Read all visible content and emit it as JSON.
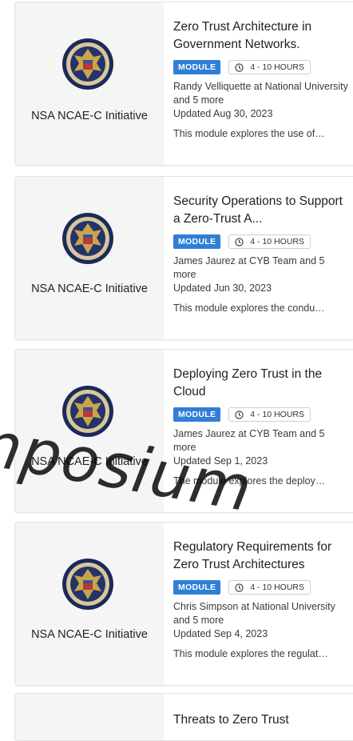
{
  "cards": [
    {
      "org": "NSA NCAE-C Initiative",
      "title": "Zero Trust Architecture in Government Networks.",
      "badge": "MODULE",
      "duration": "4 - 10 HOURS",
      "authors": "Randy Velliquette at National University and 5 more",
      "updated": "Updated Aug 30, 2023",
      "description": "This module explores the use of…"
    },
    {
      "org": "NSA NCAE-C Initiative",
      "title": "Security Operations to Support a Zero-Trust A...",
      "badge": "MODULE",
      "duration": "4 - 10 HOURS",
      "authors": "James Jaurez at CYB Team and 5 more",
      "updated": "Updated Jun 30, 2023",
      "description": "This module explores the condu…"
    },
    {
      "org": "NSA NCAE-C Initiative",
      "title": "Deploying Zero Trust in the Cloud",
      "badge": "MODULE",
      "duration": "4 - 10 HOURS",
      "authors": "James Jaurez at CYB Team and 5 more",
      "updated": "Updated Sep 1, 2023",
      "description": "The module explores the deploy…"
    },
    {
      "org": "NSA NCAE-C Initiative",
      "title": "Regulatory Requirements for Zero Trust Architectures",
      "badge": "MODULE",
      "duration": "4 - 10 HOURS",
      "authors": "Chris Simpson at National University and 5 more",
      "updated": "Updated Sep 4, 2023",
      "description": "This module explores the regulat…"
    },
    {
      "org": "",
      "title": "Threats to Zero Trust",
      "badge": "",
      "duration": "",
      "authors": "",
      "updated": "",
      "description": ""
    }
  ],
  "watermark": "mposium",
  "colors": {
    "badge": "#2f7fd6",
    "panel": "#f5f5f5"
  },
  "icons": {
    "seal": "nsa-seal-icon",
    "duration": "clock-icon"
  }
}
